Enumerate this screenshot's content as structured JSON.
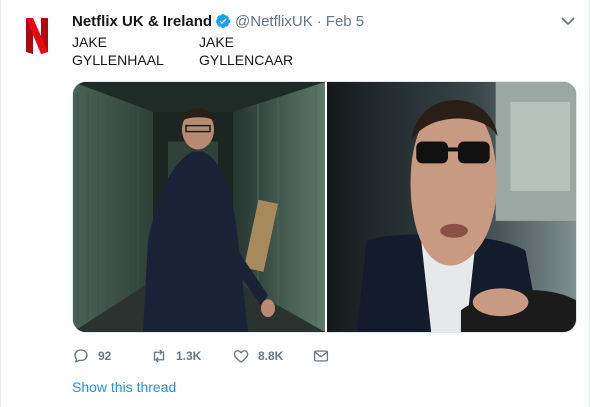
{
  "tweet": {
    "display_name": "Netflix UK & Ireland",
    "handle": "@NetflixUK",
    "separator": "·",
    "date": "Feb 5",
    "verified": true,
    "avatar_icon": "netflix-logo-icon",
    "text_lines": [
      [
        "JAKE",
        "JAKE"
      ],
      [
        "GYLLENHAAL",
        "GYLLENCAAR"
      ]
    ],
    "media": [
      {
        "kind": "photo",
        "subject": "man in suit in storage hallway"
      },
      {
        "kind": "photo",
        "subject": "man in sunglasses driving car"
      }
    ]
  },
  "actions": {
    "reply_count": "92",
    "retweet_count": "1.3K",
    "like_count": "8.8K",
    "reply_icon": "reply-icon",
    "retweet_icon": "retweet-icon",
    "like_icon": "heart-icon",
    "dm_icon": "direct-message-icon"
  },
  "show_thread_label": "Show this thread",
  "colors": {
    "netflix_red": "#e50914",
    "verified_blue": "#1da1f2",
    "link_blue": "#1b95e0",
    "secondary_text": "#657786"
  }
}
